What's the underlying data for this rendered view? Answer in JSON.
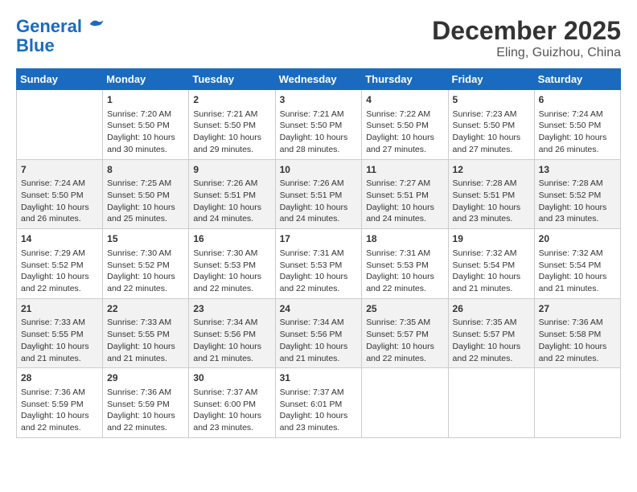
{
  "header": {
    "logo_line1": "General",
    "logo_line2": "Blue",
    "month": "December 2025",
    "location": "Eling, Guizhou, China"
  },
  "weekdays": [
    "Sunday",
    "Monday",
    "Tuesday",
    "Wednesday",
    "Thursday",
    "Friday",
    "Saturday"
  ],
  "weeks": [
    [
      {
        "day": "",
        "sunrise": "",
        "sunset": "",
        "daylight": ""
      },
      {
        "day": "1",
        "sunrise": "Sunrise: 7:20 AM",
        "sunset": "Sunset: 5:50 PM",
        "daylight": "Daylight: 10 hours and 30 minutes."
      },
      {
        "day": "2",
        "sunrise": "Sunrise: 7:21 AM",
        "sunset": "Sunset: 5:50 PM",
        "daylight": "Daylight: 10 hours and 29 minutes."
      },
      {
        "day": "3",
        "sunrise": "Sunrise: 7:21 AM",
        "sunset": "Sunset: 5:50 PM",
        "daylight": "Daylight: 10 hours and 28 minutes."
      },
      {
        "day": "4",
        "sunrise": "Sunrise: 7:22 AM",
        "sunset": "Sunset: 5:50 PM",
        "daylight": "Daylight: 10 hours and 27 minutes."
      },
      {
        "day": "5",
        "sunrise": "Sunrise: 7:23 AM",
        "sunset": "Sunset: 5:50 PM",
        "daylight": "Daylight: 10 hours and 27 minutes."
      },
      {
        "day": "6",
        "sunrise": "Sunrise: 7:24 AM",
        "sunset": "Sunset: 5:50 PM",
        "daylight": "Daylight: 10 hours and 26 minutes."
      }
    ],
    [
      {
        "day": "7",
        "sunrise": "Sunrise: 7:24 AM",
        "sunset": "Sunset: 5:50 PM",
        "daylight": "Daylight: 10 hours and 26 minutes."
      },
      {
        "day": "8",
        "sunrise": "Sunrise: 7:25 AM",
        "sunset": "Sunset: 5:50 PM",
        "daylight": "Daylight: 10 hours and 25 minutes."
      },
      {
        "day": "9",
        "sunrise": "Sunrise: 7:26 AM",
        "sunset": "Sunset: 5:51 PM",
        "daylight": "Daylight: 10 hours and 24 minutes."
      },
      {
        "day": "10",
        "sunrise": "Sunrise: 7:26 AM",
        "sunset": "Sunset: 5:51 PM",
        "daylight": "Daylight: 10 hours and 24 minutes."
      },
      {
        "day": "11",
        "sunrise": "Sunrise: 7:27 AM",
        "sunset": "Sunset: 5:51 PM",
        "daylight": "Daylight: 10 hours and 24 minutes."
      },
      {
        "day": "12",
        "sunrise": "Sunrise: 7:28 AM",
        "sunset": "Sunset: 5:51 PM",
        "daylight": "Daylight: 10 hours and 23 minutes."
      },
      {
        "day": "13",
        "sunrise": "Sunrise: 7:28 AM",
        "sunset": "Sunset: 5:52 PM",
        "daylight": "Daylight: 10 hours and 23 minutes."
      }
    ],
    [
      {
        "day": "14",
        "sunrise": "Sunrise: 7:29 AM",
        "sunset": "Sunset: 5:52 PM",
        "daylight": "Daylight: 10 hours and 22 minutes."
      },
      {
        "day": "15",
        "sunrise": "Sunrise: 7:30 AM",
        "sunset": "Sunset: 5:52 PM",
        "daylight": "Daylight: 10 hours and 22 minutes."
      },
      {
        "day": "16",
        "sunrise": "Sunrise: 7:30 AM",
        "sunset": "Sunset: 5:53 PM",
        "daylight": "Daylight: 10 hours and 22 minutes."
      },
      {
        "day": "17",
        "sunrise": "Sunrise: 7:31 AM",
        "sunset": "Sunset: 5:53 PM",
        "daylight": "Daylight: 10 hours and 22 minutes."
      },
      {
        "day": "18",
        "sunrise": "Sunrise: 7:31 AM",
        "sunset": "Sunset: 5:53 PM",
        "daylight": "Daylight: 10 hours and 22 minutes."
      },
      {
        "day": "19",
        "sunrise": "Sunrise: 7:32 AM",
        "sunset": "Sunset: 5:54 PM",
        "daylight": "Daylight: 10 hours and 21 minutes."
      },
      {
        "day": "20",
        "sunrise": "Sunrise: 7:32 AM",
        "sunset": "Sunset: 5:54 PM",
        "daylight": "Daylight: 10 hours and 21 minutes."
      }
    ],
    [
      {
        "day": "21",
        "sunrise": "Sunrise: 7:33 AM",
        "sunset": "Sunset: 5:55 PM",
        "daylight": "Daylight: 10 hours and 21 minutes."
      },
      {
        "day": "22",
        "sunrise": "Sunrise: 7:33 AM",
        "sunset": "Sunset: 5:55 PM",
        "daylight": "Daylight: 10 hours and 21 minutes."
      },
      {
        "day": "23",
        "sunrise": "Sunrise: 7:34 AM",
        "sunset": "Sunset: 5:56 PM",
        "daylight": "Daylight: 10 hours and 21 minutes."
      },
      {
        "day": "24",
        "sunrise": "Sunrise: 7:34 AM",
        "sunset": "Sunset: 5:56 PM",
        "daylight": "Daylight: 10 hours and 21 minutes."
      },
      {
        "day": "25",
        "sunrise": "Sunrise: 7:35 AM",
        "sunset": "Sunset: 5:57 PM",
        "daylight": "Daylight: 10 hours and 22 minutes."
      },
      {
        "day": "26",
        "sunrise": "Sunrise: 7:35 AM",
        "sunset": "Sunset: 5:57 PM",
        "daylight": "Daylight: 10 hours and 22 minutes."
      },
      {
        "day": "27",
        "sunrise": "Sunrise: 7:36 AM",
        "sunset": "Sunset: 5:58 PM",
        "daylight": "Daylight: 10 hours and 22 minutes."
      }
    ],
    [
      {
        "day": "28",
        "sunrise": "Sunrise: 7:36 AM",
        "sunset": "Sunset: 5:59 PM",
        "daylight": "Daylight: 10 hours and 22 minutes."
      },
      {
        "day": "29",
        "sunrise": "Sunrise: 7:36 AM",
        "sunset": "Sunset: 5:59 PM",
        "daylight": "Daylight: 10 hours and 22 minutes."
      },
      {
        "day": "30",
        "sunrise": "Sunrise: 7:37 AM",
        "sunset": "Sunset: 6:00 PM",
        "daylight": "Daylight: 10 hours and 23 minutes."
      },
      {
        "day": "31",
        "sunrise": "Sunrise: 7:37 AM",
        "sunset": "Sunset: 6:01 PM",
        "daylight": "Daylight: 10 hours and 23 minutes."
      },
      {
        "day": "",
        "sunrise": "",
        "sunset": "",
        "daylight": ""
      },
      {
        "day": "",
        "sunrise": "",
        "sunset": "",
        "daylight": ""
      },
      {
        "day": "",
        "sunrise": "",
        "sunset": "",
        "daylight": ""
      }
    ]
  ]
}
